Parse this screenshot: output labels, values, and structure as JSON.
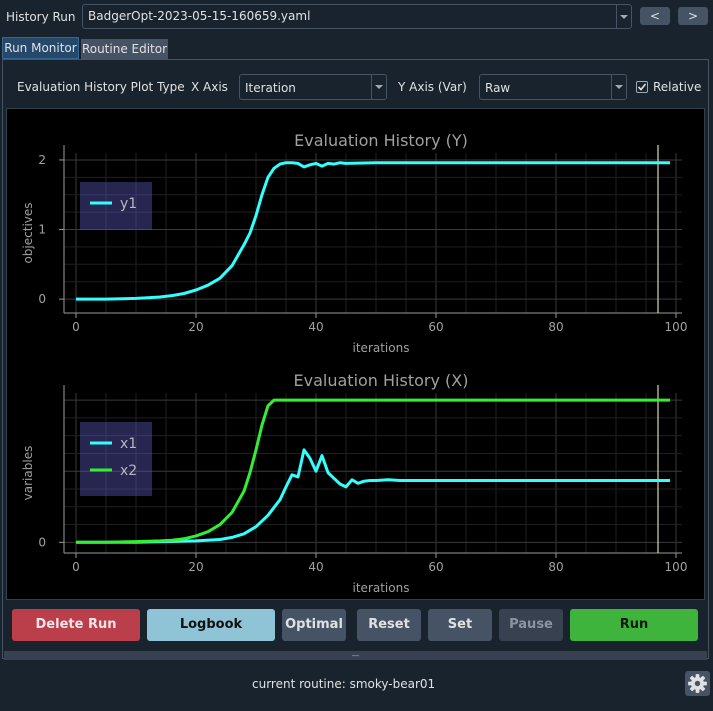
{
  "header": {
    "history_run_label": "History Run",
    "history_run_value": "BadgerOpt-2023-05-15-160659.yaml",
    "prev_label": "<",
    "next_label": ">"
  },
  "tabs": [
    {
      "label": "Run Monitor",
      "active": true
    },
    {
      "label": "Routine Editor",
      "active": false
    }
  ],
  "controls": {
    "plot_type_label": "Evaluation History Plot Type",
    "x_axis_label": "X Axis",
    "x_axis_value": "Iteration",
    "y_axis_label": "Y Axis (Var)",
    "y_axis_value": "Raw",
    "relative_label": "Relative",
    "relative_checked": true
  },
  "colors": {
    "y1": "#33ffff",
    "x1": "#33ffff",
    "x2": "#33ee33",
    "accent": "#26486b"
  },
  "chart_data": [
    {
      "type": "line",
      "title": "Evaluation History (Y)",
      "xlabel": "iterations",
      "ylabel": "objectives",
      "xlim": [
        -2,
        101
      ],
      "ylim": [
        -0.2,
        2.1
      ],
      "xticks": [
        0,
        20,
        40,
        60,
        80,
        100
      ],
      "yticks": [
        0,
        1,
        2
      ],
      "grid": true,
      "legend": "top-left",
      "cursor_x": 97,
      "series": [
        {
          "name": "y1",
          "color": "#33ffff",
          "x": [
            0,
            5,
            10,
            12,
            14,
            16,
            18,
            20,
            22,
            24,
            26,
            28,
            29,
            30,
            31,
            32,
            33,
            34,
            35,
            36,
            37,
            38,
            39,
            40,
            41,
            42,
            43,
            44,
            45,
            50,
            60,
            70,
            80,
            90,
            99
          ],
          "y": [
            0,
            0,
            0.01,
            0.02,
            0.03,
            0.05,
            0.08,
            0.13,
            0.2,
            0.3,
            0.48,
            0.78,
            0.95,
            1.2,
            1.5,
            1.75,
            1.88,
            1.94,
            1.96,
            1.96,
            1.95,
            1.9,
            1.93,
            1.95,
            1.91,
            1.95,
            1.94,
            1.96,
            1.95,
            1.96,
            1.96,
            1.96,
            1.96,
            1.96,
            1.96
          ]
        }
      ]
    },
    {
      "type": "line",
      "title": "Evaluation History (X)",
      "xlabel": "iterations",
      "ylabel": "variables",
      "xlim": [
        -2,
        101
      ],
      "ylim": [
        -0.15,
        2.1
      ],
      "xticks": [
        0,
        20,
        40,
        60,
        80,
        100
      ],
      "yticks": [
        0
      ],
      "grid": true,
      "legend": "top-left",
      "cursor_x": 97,
      "series": [
        {
          "name": "x1",
          "color": "#33ffff",
          "x": [
            0,
            10,
            20,
            24,
            26,
            28,
            30,
            32,
            34,
            35,
            36,
            37,
            38,
            39,
            40,
            41,
            42,
            43,
            44,
            45,
            46,
            47,
            48,
            49,
            50,
            52,
            54,
            56,
            60,
            70,
            80,
            90,
            99
          ],
          "y": [
            0,
            0,
            0.02,
            0.04,
            0.07,
            0.12,
            0.22,
            0.38,
            0.6,
            0.78,
            0.95,
            0.92,
            1.3,
            1.18,
            1.0,
            1.22,
            0.98,
            0.9,
            0.82,
            0.78,
            0.88,
            0.83,
            0.86,
            0.87,
            0.87,
            0.88,
            0.87,
            0.87,
            0.87,
            0.87,
            0.87,
            0.87,
            0.87
          ]
        },
        {
          "name": "x2",
          "color": "#33ee33",
          "x": [
            0,
            5,
            10,
            14,
            16,
            18,
            20,
            22,
            24,
            26,
            28,
            29,
            30,
            31,
            32,
            33,
            34,
            40,
            60,
            80,
            99
          ],
          "y": [
            0,
            0,
            0.01,
            0.02,
            0.03,
            0.05,
            0.09,
            0.15,
            0.25,
            0.42,
            0.72,
            0.98,
            1.3,
            1.65,
            1.92,
            2.0,
            2.0,
            2.0,
            2.0,
            2.0,
            2.0
          ]
        }
      ]
    }
  ],
  "buttons": {
    "delete_run": "Delete Run",
    "logbook": "Logbook",
    "optimal": "Optimal",
    "reset": "Reset",
    "set": "Set",
    "pause": "Pause",
    "run": "Run"
  },
  "footer": {
    "splitter": "—",
    "current_routine": "current routine: smoky-bear01"
  }
}
